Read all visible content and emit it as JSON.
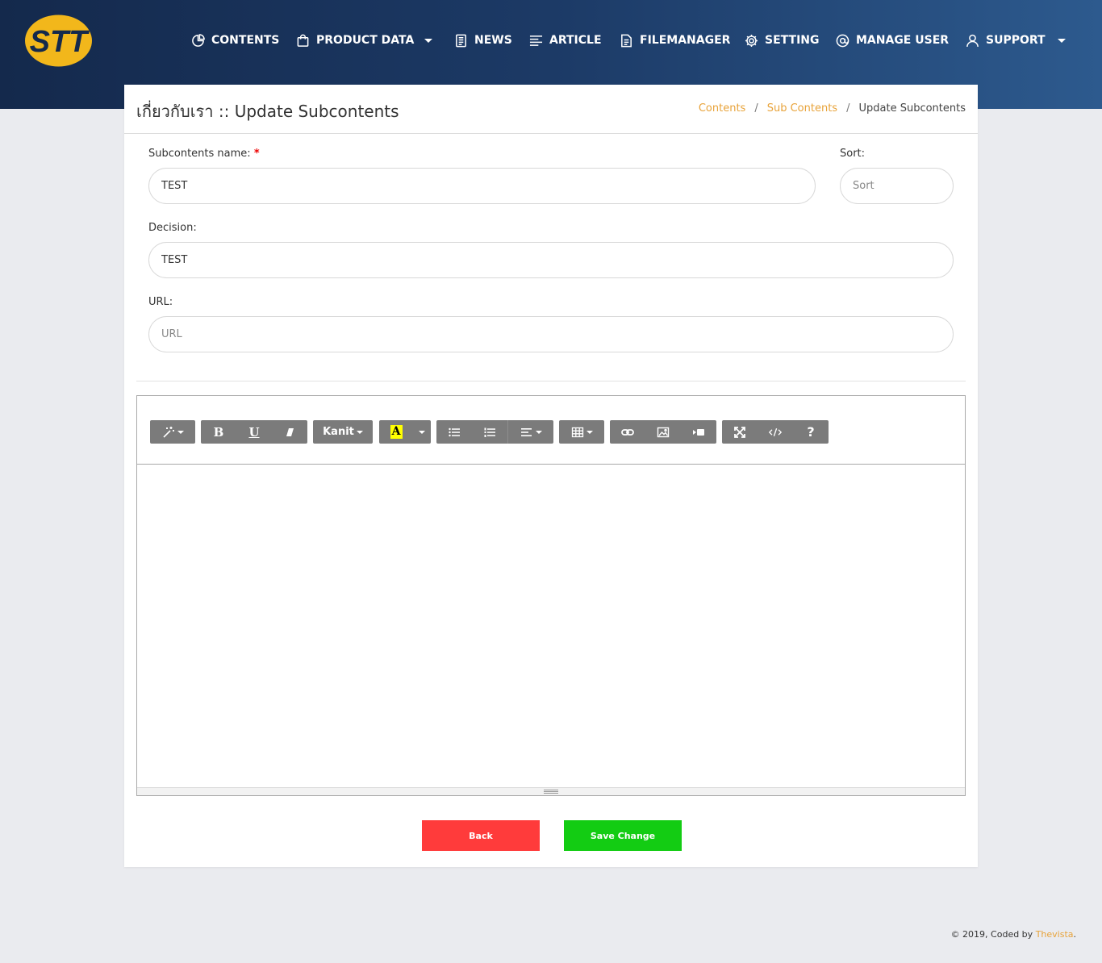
{
  "logo": {
    "text": "STT",
    "color": "#f2b71b"
  },
  "nav": [
    {
      "label": "CONTENTS",
      "icon": "pie-chart-icon"
    },
    {
      "label": "PRODUCT DATA",
      "icon": "shopping-bag-icon",
      "has_dropdown": true
    },
    {
      "label": "NEWS",
      "icon": "document-icon"
    },
    {
      "label": "ARTICLE",
      "icon": "text-align-icon"
    },
    {
      "label": "FILEMANAGER",
      "icon": "file-icon"
    },
    {
      "label": "SETTING",
      "icon": "gear-icon"
    },
    {
      "label": "MANAGE USER",
      "icon": "at-sign-icon"
    },
    {
      "label": "SUPPORT",
      "icon": "user-icon",
      "has_dropdown": true
    }
  ],
  "page": {
    "title": "เกี่ยวกับเรา :: Update Subcontents",
    "breadcrumb": [
      "Contents",
      "Sub Contents",
      "Update Subcontents"
    ],
    "breadcrumb_sep": "/"
  },
  "form": {
    "name_label": "Subcontents name:",
    "required_mark": "*",
    "name_value": "TEST",
    "sort_label": "Sort:",
    "sort_value": "",
    "sort_placeholder": "Sort",
    "decision_label": "Decision:",
    "decision_value": "TEST",
    "url_label": "URL:",
    "url_value": "",
    "url_placeholder": "URL"
  },
  "editor": {
    "font_name": "Kanit",
    "color_letter": "A",
    "content": "",
    "toolbar_icons": [
      "magic-wand-icon",
      "bold-icon",
      "underline-icon",
      "eraser-icon",
      "font-name-select",
      "text-color-icon",
      "unordered-list-icon",
      "ordered-list-icon",
      "paragraph-align-icon",
      "table-icon",
      "link-icon",
      "picture-icon",
      "video-icon",
      "fullscreen-icon",
      "code-view-icon",
      "help-icon"
    ]
  },
  "buttons": {
    "back": "Back",
    "save": "Save Change"
  },
  "footer": {
    "prefix": "© 2019, Coded by",
    "brand": "Thevista",
    "suffix": "."
  },
  "colors": {
    "accent": "#e8a33a",
    "back": "#ff3b3b",
    "save": "#13cc13",
    "toolbar": "#7b7b7b",
    "nav_bg_start": "#14294c",
    "nav_bg_end": "#2d5a8e"
  }
}
